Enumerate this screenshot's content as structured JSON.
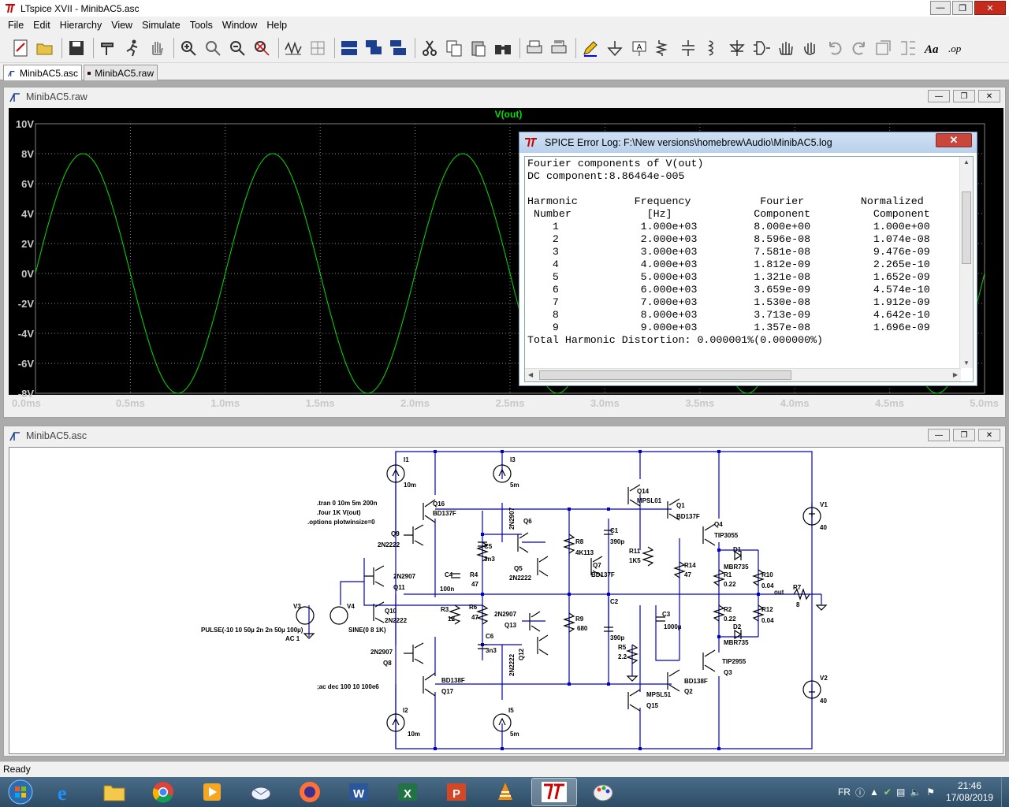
{
  "app": {
    "title": "LTspice XVII - MinibAC5.asc"
  },
  "menu": [
    "File",
    "Edit",
    "Hierarchy",
    "View",
    "Simulate",
    "Tools",
    "Window",
    "Help"
  ],
  "tabs": [
    {
      "label": "MinibAC5.asc"
    },
    {
      "label": "MinibAC5.raw"
    }
  ],
  "plot_window": {
    "title": "MinibAC5.raw"
  },
  "chart_data": {
    "type": "line",
    "title": "V(out)",
    "series": [
      {
        "name": "V(out)",
        "color": "#00e000",
        "function": "sine",
        "amplitude": 8,
        "frequency_hz": 1000,
        "offset": 0
      }
    ],
    "xlabel": "",
    "ylabel": "",
    "xlim": [
      0,
      5.0
    ],
    "ylim": [
      -8,
      10
    ],
    "x_ticks": [
      "0.0ms",
      "0.5ms",
      "1.0ms",
      "1.5ms",
      "2.0ms",
      "2.5ms",
      "3.0ms",
      "3.5ms",
      "4.0ms",
      "4.5ms",
      "5.0ms"
    ],
    "y_ticks": [
      "10V",
      "8V",
      "6V",
      "4V",
      "2V",
      "0V",
      "-2V",
      "-4V",
      "-6V",
      "-8V"
    ],
    "grid": true
  },
  "log": {
    "title": "SPICE Error Log: F:\\New versions\\homebrew\\Audio\\MinibAC5.log",
    "heading": "Fourier components of V(out)",
    "dc": "DC component:8.86464e-005",
    "columns": [
      [
        "Harmonic",
        "Number"
      ],
      [
        "Frequency",
        "[Hz]"
      ],
      [
        "Fourier",
        "Component"
      ],
      [
        "Normalized",
        "Component"
      ]
    ],
    "rows": [
      [
        "1",
        "1.000e+03",
        "8.000e+00",
        "1.000e+00"
      ],
      [
        "2",
        "2.000e+03",
        "8.596e-08",
        "1.074e-08"
      ],
      [
        "3",
        "3.000e+03",
        "7.581e-08",
        "9.476e-09"
      ],
      [
        "4",
        "4.000e+03",
        "1.812e-09",
        "2.265e-10"
      ],
      [
        "5",
        "5.000e+03",
        "1.321e-08",
        "1.652e-09"
      ],
      [
        "6",
        "6.000e+03",
        "3.659e-09",
        "4.574e-10"
      ],
      [
        "7",
        "7.000e+03",
        "1.530e-08",
        "1.912e-09"
      ],
      [
        "8",
        "8.000e+03",
        "3.713e-09",
        "4.642e-10"
      ],
      [
        "9",
        "9.000e+03",
        "1.357e-08",
        "1.696e-09"
      ]
    ],
    "thd": "Total Harmonic Distortion: 0.000001%(0.000000%)"
  },
  "schematic_window": {
    "title": "MinibAC5.asc"
  },
  "schematic": {
    "directives": [
      ".tran 0 10m 5m 200n",
      ".four 1K V(out)",
      ".options plotwinsize=0"
    ],
    "ac_directive": ";ac dec 100 10 100e6",
    "labels": [
      {
        "t": "I1"
      },
      {
        "t": "10m"
      },
      {
        "t": "I3"
      },
      {
        "t": "5m"
      },
      {
        "t": "Q16"
      },
      {
        "t": "BD137F"
      },
      {
        "t": "2N2907"
      },
      {
        "t": "Q6"
      },
      {
        "t": "Q9"
      },
      {
        "t": "2N2222"
      },
      {
        "t": "C5"
      },
      {
        "t": "3n3"
      },
      {
        "t": "Q5"
      },
      {
        "t": "2N2222"
      },
      {
        "t": "R4"
      },
      {
        "t": "47"
      },
      {
        "t": "C4"
      },
      {
        "t": "100n"
      },
      {
        "t": "2N2907"
      },
      {
        "t": "Q11"
      },
      {
        "t": "V3"
      },
      {
        "t": "V4"
      },
      {
        "t": "Q10"
      },
      {
        "t": "2N2222"
      },
      {
        "t": "PULSE(-10 10 50µ 2n 2n 50µ 100µ)"
      },
      {
        "t": "AC 1"
      },
      {
        "t": "SINE(0 8 1K)"
      },
      {
        "t": "R3"
      },
      {
        "t": "12"
      },
      {
        "t": "R6"
      },
      {
        "t": "47"
      },
      {
        "t": "2N2907"
      },
      {
        "t": "Q13"
      },
      {
        "t": "C6"
      },
      {
        "t": "3n3"
      },
      {
        "t": "2N2907"
      },
      {
        "t": "Q8"
      },
      {
        "t": "2N2222"
      },
      {
        "t": "Q12"
      },
      {
        "t": "BD138F"
      },
      {
        "t": "Q17"
      },
      {
        "t": "I2"
      },
      {
        "t": "10m"
      },
      {
        "t": "I5"
      },
      {
        "t": "5m"
      },
      {
        "t": "R8"
      },
      {
        "t": "4K113"
      },
      {
        "t": "C1"
      },
      {
        "t": "390p"
      },
      {
        "t": "Q7"
      },
      {
        "t": "BD137F"
      },
      {
        "t": "R9"
      },
      {
        "t": "680"
      },
      {
        "t": "C2"
      },
      {
        "t": "390p"
      },
      {
        "t": "R5"
      },
      {
        "t": "2.2"
      },
      {
        "t": "Q14"
      },
      {
        "t": "MPSL01"
      },
      {
        "t": "R11"
      },
      {
        "t": "1K5"
      },
      {
        "t": "Q1"
      },
      {
        "t": "BD137F"
      },
      {
        "t": "R14"
      },
      {
        "t": "47"
      },
      {
        "t": "C3"
      },
      {
        "t": "1000µ"
      },
      {
        "t": "Q15"
      },
      {
        "t": "MPSL51"
      },
      {
        "t": "Q2"
      },
      {
        "t": "BD138F"
      },
      {
        "t": "Q4"
      },
      {
        "t": "TIP3055"
      },
      {
        "t": "D1"
      },
      {
        "t": "MBR735"
      },
      {
        "t": "R1"
      },
      {
        "t": "0.22"
      },
      {
        "t": "R10"
      },
      {
        "t": "0.04"
      },
      {
        "t": "out"
      },
      {
        "t": "R7"
      },
      {
        "t": "8"
      },
      {
        "t": "R2"
      },
      {
        "t": "0.22"
      },
      {
        "t": "R12"
      },
      {
        "t": "0.04"
      },
      {
        "t": "D2"
      },
      {
        "t": "MBR735"
      },
      {
        "t": "TIP2955"
      },
      {
        "t": "Q3"
      },
      {
        "t": "V1"
      },
      {
        "t": "40"
      },
      {
        "t": "V2"
      },
      {
        "t": "40"
      }
    ]
  },
  "status": "Ready",
  "taskbar": {
    "lang": "FR",
    "time": "21:46",
    "date": "17/08/2019"
  }
}
